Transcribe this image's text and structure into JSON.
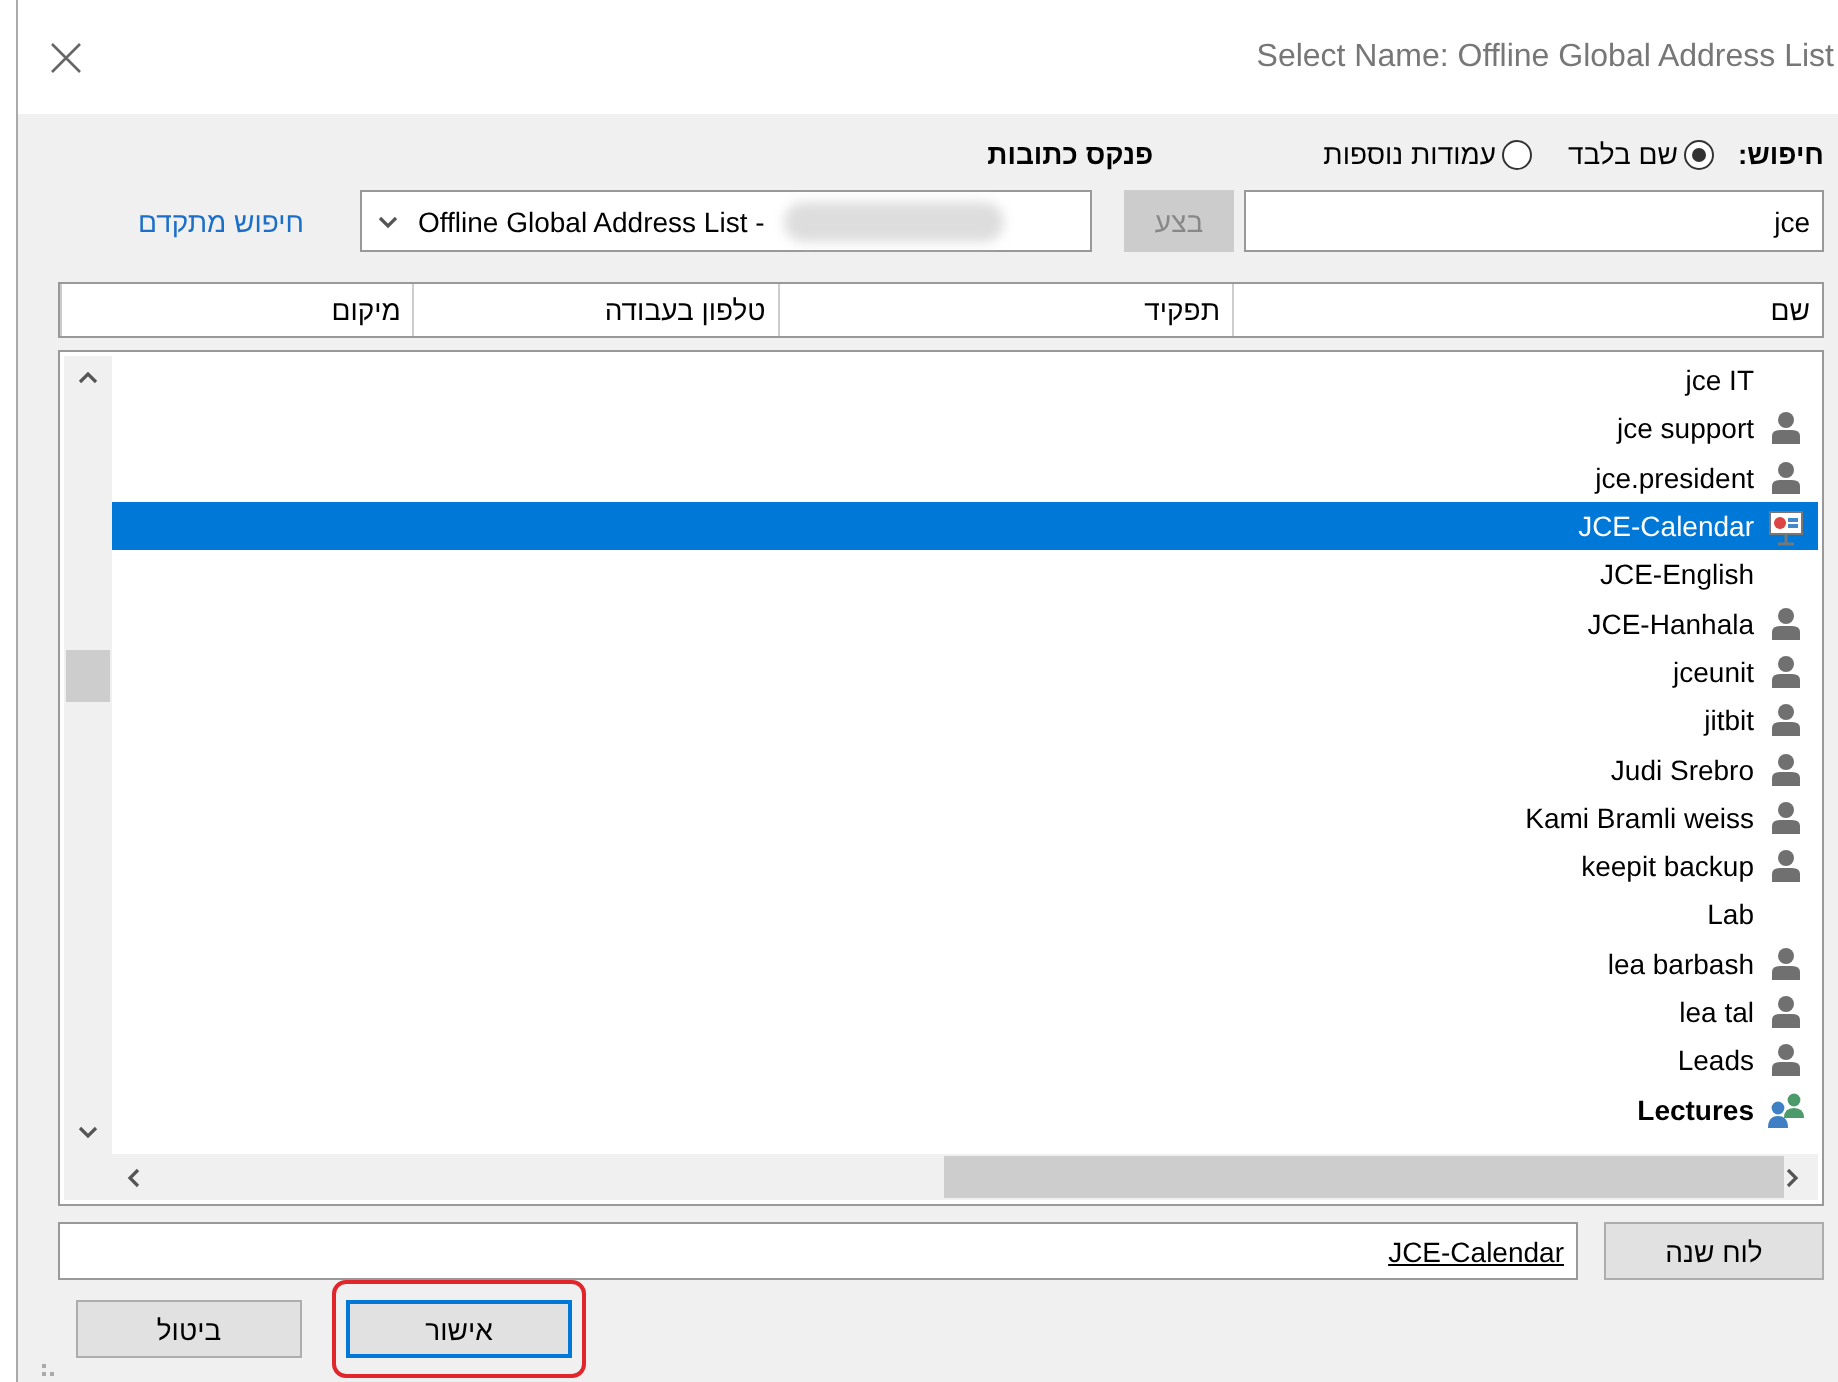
{
  "window": {
    "title": "Select Name: Offline Global Address List"
  },
  "search": {
    "label": "חיפוש:",
    "options": [
      {
        "label": "שם בלבד",
        "selected": true
      },
      {
        "label": "עמודות נוספות",
        "selected": false
      }
    ],
    "value": "jce",
    "go_button": {
      "label": "בצע",
      "disabled": true
    },
    "address_book": {
      "label": "פנקס כתובות",
      "value": "Offline Global Address List -"
    },
    "advanced_link": "חיפוש מתקדם"
  },
  "table": {
    "columns": [
      "שם",
      "תפקיד",
      "טלפון בעבודה",
      "מיקום"
    ],
    "rows": [
      {
        "name": "jce IT",
        "kind": "none",
        "bold": false,
        "selected": false
      },
      {
        "name": "jce support",
        "kind": "person",
        "bold": false,
        "selected": false
      },
      {
        "name": "jce.president",
        "kind": "person",
        "bold": false,
        "selected": false
      },
      {
        "name": "JCE-Calendar",
        "kind": "resource",
        "bold": false,
        "selected": true
      },
      {
        "name": "JCE-English",
        "kind": "none",
        "bold": false,
        "selected": false
      },
      {
        "name": "JCE-Hanhala",
        "kind": "person",
        "bold": false,
        "selected": false
      },
      {
        "name": "jceunit",
        "kind": "person",
        "bold": false,
        "selected": false
      },
      {
        "name": "jitbit",
        "kind": "person",
        "bold": false,
        "selected": false
      },
      {
        "name": "Judi Srebro",
        "kind": "person",
        "bold": false,
        "selected": false
      },
      {
        "name": "Kami Bramli weiss",
        "kind": "person",
        "bold": false,
        "selected": false
      },
      {
        "name": "keepit backup",
        "kind": "person",
        "bold": false,
        "selected": false
      },
      {
        "name": "Lab",
        "kind": "none",
        "bold": false,
        "selected": false
      },
      {
        "name": "lea barbash",
        "kind": "person",
        "bold": false,
        "selected": false
      },
      {
        "name": "lea tal",
        "kind": "person",
        "bold": false,
        "selected": false
      },
      {
        "name": "Leads",
        "kind": "person",
        "bold": false,
        "selected": false
      },
      {
        "name": "Lectures",
        "kind": "group",
        "bold": true,
        "selected": false
      }
    ]
  },
  "recipient": {
    "button": "לוח שנה",
    "value": "JCE-Calendar"
  },
  "buttons": [
    {
      "label": "אישור",
      "focused": true,
      "highlighted": true
    },
    {
      "label": "ביטול",
      "focused": false,
      "highlighted": false
    }
  ]
}
